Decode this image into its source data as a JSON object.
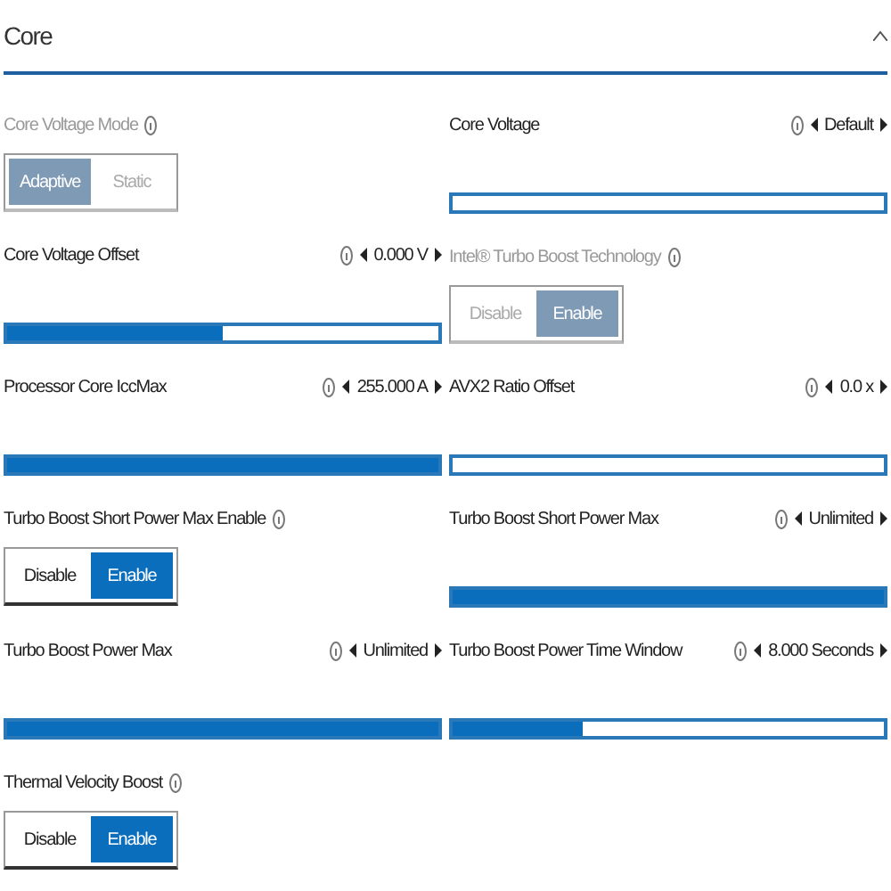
{
  "section": {
    "title": "Core",
    "expanded": true
  },
  "columns": [
    [
      {
        "kind": "toggle",
        "label": "Core Voltage Mode",
        "disabled": true,
        "options": [
          {
            "label": "Adaptive",
            "selected": true
          },
          {
            "label": "Static",
            "selected": false
          }
        ]
      },
      {
        "kind": "slider",
        "label": "Core Voltage Offset",
        "reading": "0.000 V",
        "level": 0.5
      },
      {
        "kind": "slider",
        "label": "Processor Core IccMax",
        "reading": "255.000 A",
        "level": 1
      },
      {
        "kind": "toggle",
        "label": "Turbo Boost Short Power Max Enable",
        "disabled": false,
        "options": [
          {
            "label": "Disable",
            "selected": false
          },
          {
            "label": "Enable",
            "selected": true
          }
        ]
      },
      {
        "kind": "slider",
        "label": "Turbo Boost Power Max",
        "reading": "Unlimited",
        "level": 1
      },
      {
        "kind": "toggle",
        "label": "Thermal Velocity Boost",
        "disabled": false,
        "options": [
          {
            "label": "Disable",
            "selected": false
          },
          {
            "label": "Enable",
            "selected": true
          }
        ]
      }
    ],
    [
      {
        "kind": "slider",
        "label": "Core Voltage",
        "reading": "Default"
      },
      {
        "kind": "toggle",
        "label": "Intel® Turbo Boost Technology",
        "disabled": true,
        "options": [
          {
            "label": "Disable",
            "selected": false
          },
          {
            "label": "Enable",
            "selected": true
          }
        ]
      },
      {
        "kind": "slider",
        "label": "AVX2 Ratio Offset",
        "reading": "0.0 x"
      },
      {
        "kind": "slider",
        "label": "Turbo Boost Short Power Max",
        "reading": "Unlimited",
        "level": 1
      },
      {
        "kind": "slider",
        "label": "Turbo Boost Power Time Window",
        "reading": "8.000 Seconds",
        "level": 0.3
      }
    ]
  ]
}
